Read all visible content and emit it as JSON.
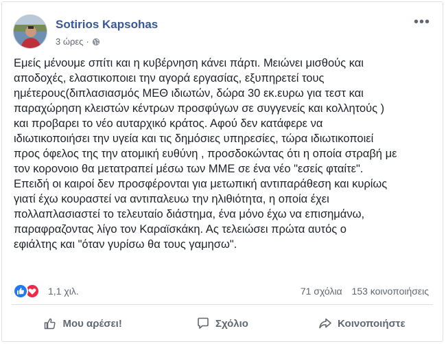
{
  "post": {
    "author": "Sotirios Kapsohas",
    "time": "3 ώρες",
    "separator": "·",
    "privacy_icon": "globe-icon",
    "more_label": "•••",
    "text": "Εμείς μένουμε σπίτι και η κυβέρνηση κάνει πάρτι. Μειώνει μισθούς και\nαποδοχές, ελαστικοποιει την αγορά εργασίας, εξυπηρετεί τους\nημέτερους(διπλασιασμός ΜΕΘ ιδιωτών, δώρα 30 εκ.ευρω για τεστ και\nπαραχώρηση κλειστών κέντρων προσφύγων σε συγγενείς και κολλητούς )\nκαι προβαρει το νέο αυταρχικό κράτος. Αφού δεν κατάφερε να\nιδιωτικοποιήσει την υγεία και τις δημόσιες υπηρεσίες, τώρα ιδιωτικοποιεί\nπρος όφελος της την ατομική ευθύνη , προσδοκώντας ότι η οποία στραβή με\nτον κορονοιο θα μετατραπεί μέσω των ΜΜΕ σε ένα νέο \"εσείς φταίτε\".\nΕπειδή οι καιροί δεν προσφέρονται για μετωπική αντιπαράθεση και κυρίως\nγιατί έχω κουραστεί να αντιπαλευω την ηλιθιότητα, η οποία έχει\nπολλαπλασιαστεί το τελευταίο διάστημα, ένα μόνο έχω να επισημάνω,\nπαραφραζοντας λίγο τον Καραϊσκάκη. Ας τελειώσει πρώτα αυτός ο\nεφιάλτης και \"όταν γυρίσω θα τους γαμησω\"."
  },
  "reactions": {
    "icons": [
      "like-icon",
      "love-icon"
    ],
    "count": "1,1 χιλ.",
    "comments": "71 σχόλια",
    "shares": "153 κοινοποιήσεις"
  },
  "actions": {
    "like": "Μου αρέσει!",
    "comment": "Σχόλιο",
    "share": "Κοινοποιήστε"
  },
  "colors": {
    "author": "#385898",
    "like": "#2078f4",
    "love": "#f0284a",
    "secondary_text": "#606770"
  }
}
